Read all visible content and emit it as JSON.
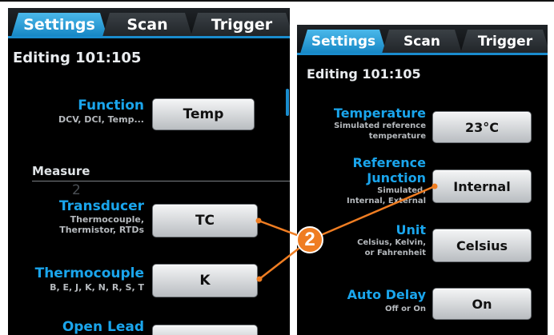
{
  "left_screen": {
    "tabs": [
      "Settings",
      "Scan",
      "Trigger"
    ],
    "editing": "Editing 101:105",
    "function": {
      "label": "Function",
      "sub": "DCV, DCI, Temp...",
      "value": "Temp"
    },
    "measure_heading": "Measure",
    "transducer": {
      "label": "Transducer",
      "sub1": "Thermocouple,",
      "sub2": "Thermistor, RTDs",
      "value": "TC"
    },
    "thermocouple": {
      "label": "Thermocouple",
      "sub": "B, E, J, K, N, R, S, T",
      "value": "K"
    },
    "open_lead": {
      "label": "Open Lead"
    },
    "watermark": "2"
  },
  "right_screen": {
    "tabs": [
      "Settings",
      "Scan",
      "Trigger"
    ],
    "editing": "Editing 101:105",
    "temperature": {
      "label": "Temperature",
      "sub1": "Simulated reference",
      "sub2": "temperature",
      "value": "23°C"
    },
    "reference_junction": {
      "label1": "Reference",
      "label2": "Junction",
      "sub1": "Simulated,",
      "sub2": "Internal, External",
      "value": "Internal"
    },
    "unit": {
      "label": "Unit",
      "sub1": "Celsius, Kelvin,",
      "sub2": "or Fahrenheit",
      "value": "Celsius"
    },
    "auto_delay": {
      "label": "Auto Delay",
      "sub": "Off or On",
      "value": "On"
    }
  },
  "callout": {
    "number": "2",
    "color": "#ef7d22"
  },
  "colors": {
    "accent": "#1aa5ec",
    "tab_active": "#1586c4",
    "background": "#000000"
  }
}
